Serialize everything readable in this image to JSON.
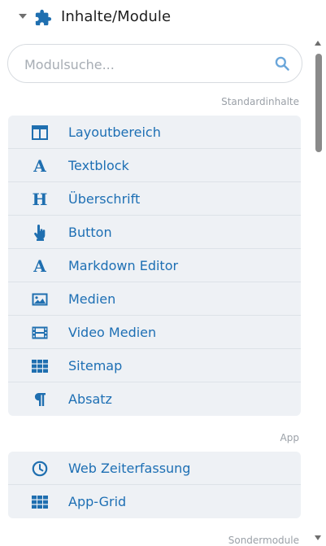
{
  "panel": {
    "title": "Inhalte/Module"
  },
  "search": {
    "placeholder": "Modulsuche...",
    "value": ""
  },
  "groups": {
    "standard": {
      "label": "Standardinhalte",
      "items": [
        {
          "label": "Layoutbereich",
          "icon": "layout-columns-icon"
        },
        {
          "label": "Textblock",
          "icon": "letter-a-icon"
        },
        {
          "label": "Überschrift",
          "icon": "letter-h-icon"
        },
        {
          "label": "Button",
          "icon": "pointer-hand-icon"
        },
        {
          "label": "Markdown Editor",
          "icon": "letter-a-icon"
        },
        {
          "label": "Medien",
          "icon": "image-icon"
        },
        {
          "label": "Video Medien",
          "icon": "film-icon"
        },
        {
          "label": "Sitemap",
          "icon": "grid-icon"
        },
        {
          "label": "Absatz",
          "icon": "paragraph-icon"
        }
      ]
    },
    "app": {
      "label": "App",
      "items": [
        {
          "label": "Web Zeiterfassung",
          "icon": "clock-icon"
        },
        {
          "label": "App-Grid",
          "icon": "grid-icon"
        }
      ]
    },
    "special": {
      "label": "Sondermodule"
    }
  },
  "colors": {
    "accent": "#1d6fb4",
    "item_bg": "#eef1f5",
    "muted": "#9ba1a8"
  }
}
